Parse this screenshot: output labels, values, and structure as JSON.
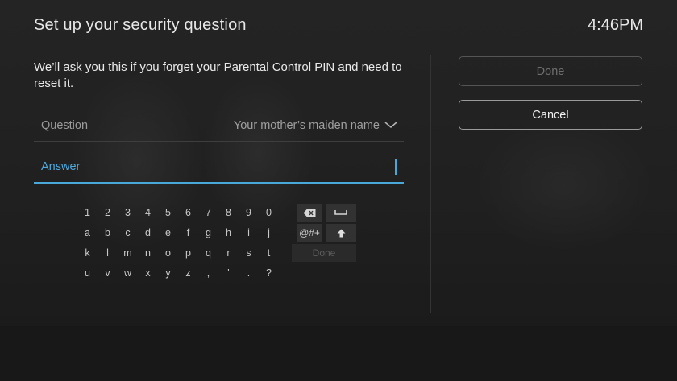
{
  "header": {
    "title": "Set up your security question",
    "time": "4:46PM"
  },
  "intro": {
    "text": "We’ll ask you this if you forget your Parental Control PIN and need to reset it."
  },
  "form": {
    "question_label": "Question",
    "question_value": "Your mother’s maiden name",
    "answer_label": "Answer",
    "answer_value": ""
  },
  "keyboard": {
    "rows": [
      [
        "1",
        "2",
        "3",
        "4",
        "5",
        "6",
        "7",
        "8",
        "9",
        "0"
      ],
      [
        "a",
        "b",
        "c",
        "d",
        "e",
        "f",
        "g",
        "h",
        "i",
        "j"
      ],
      [
        "k",
        "l",
        "m",
        "n",
        "o",
        "p",
        "q",
        "r",
        "s",
        "t"
      ],
      [
        "u",
        "v",
        "w",
        "x",
        "y",
        "z",
        ",",
        "'",
        ".",
        "?"
      ]
    ],
    "backspace_icon": "backspace-icon",
    "space_icon": "space-icon",
    "symbols_label": "@#+",
    "shift_icon": "shift-icon",
    "done_label": "Done"
  },
  "actions": {
    "done_label": "Done",
    "cancel_label": "Cancel"
  },
  "colors": {
    "accent": "#4aa8d8",
    "background": "#1c1c1c"
  }
}
